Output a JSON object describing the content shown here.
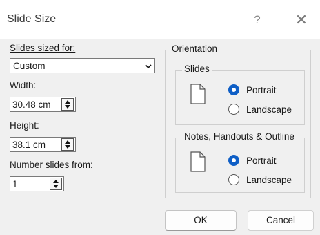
{
  "window": {
    "title": "Slide Size",
    "help_glyph": "?",
    "close_glyph": "✕"
  },
  "slides_sized_for": {
    "label": "Slides sized for:",
    "value": "Custom"
  },
  "width": {
    "label": "Width:",
    "value": "30.48 cm"
  },
  "height": {
    "label": "Height:",
    "value": "38.1 cm"
  },
  "number_from": {
    "label": "Number slides from:",
    "value": "1"
  },
  "orientation": {
    "title": "Orientation",
    "slides": {
      "title": "Slides",
      "portrait": "Portrait",
      "landscape": "Landscape",
      "selected": "portrait"
    },
    "notes": {
      "title": "Notes, Handouts & Outline",
      "portrait": "Portrait",
      "landscape": "Landscape",
      "selected": "portrait"
    }
  },
  "buttons": {
    "ok": "OK",
    "cancel": "Cancel"
  },
  "colors": {
    "accent": "#0f5fc6",
    "background": "#f0f0f0",
    "titlebar": "#ffffff"
  }
}
